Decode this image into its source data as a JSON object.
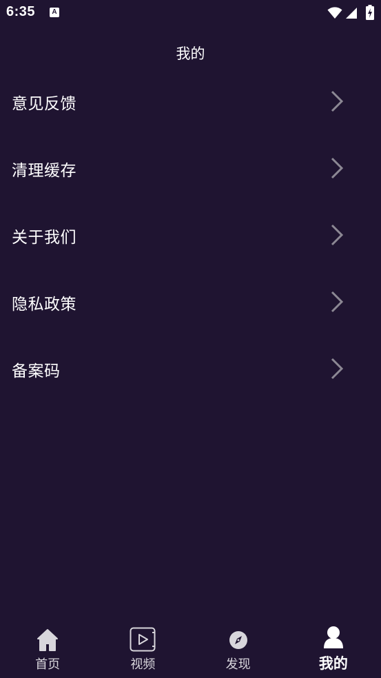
{
  "status_bar": {
    "time": "6:35",
    "icons": [
      "a-notification-icon",
      "wifi-icon",
      "signal-icon",
      "battery-charging-icon"
    ]
  },
  "header": {
    "title": "我的"
  },
  "menu": {
    "items": [
      {
        "label": "意见反馈",
        "icon": "chevron-right-icon"
      },
      {
        "label": "清理缓存",
        "icon": "chevron-right-icon"
      },
      {
        "label": "关于我们",
        "icon": "chevron-right-icon"
      },
      {
        "label": "隐私政策",
        "icon": "chevron-right-icon"
      },
      {
        "label": "备案码",
        "icon": "chevron-right-icon"
      }
    ]
  },
  "bottom_nav": {
    "tabs": [
      {
        "label": "首页",
        "icon": "home-icon",
        "active": false
      },
      {
        "label": "视频",
        "icon": "video-icon",
        "active": false
      },
      {
        "label": "发现",
        "icon": "compass-icon",
        "active": false
      },
      {
        "label": "我的",
        "icon": "profile-icon",
        "active": true
      }
    ]
  },
  "colors": {
    "background": "#1f1431",
    "text": "#ffffff",
    "chevron": "#8c8894",
    "nav_inactive": "#d8d6dc"
  }
}
